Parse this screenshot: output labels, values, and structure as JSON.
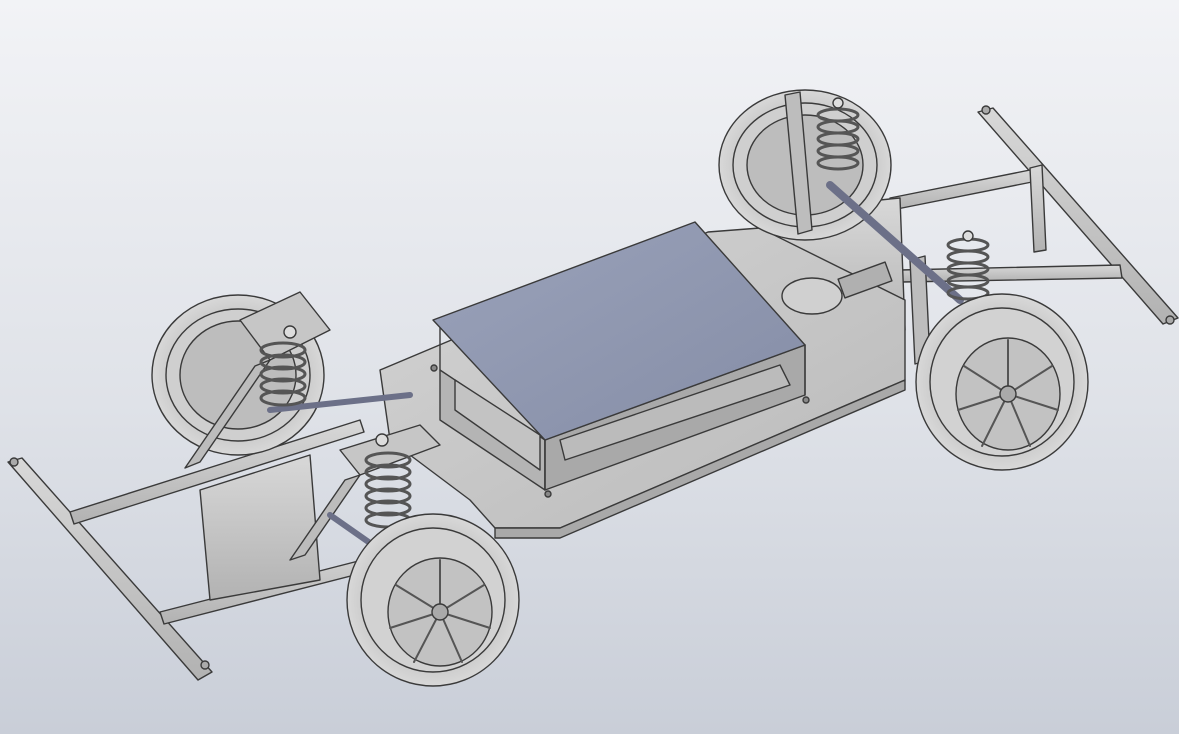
{
  "viewport": {
    "background_top": "#f2f3f6",
    "background_bottom": "#c9ced8"
  },
  "model": {
    "frame_color": "#c9c9c9",
    "frame_edge_color": "#3a3a3a",
    "tire_color": "#c8c8c8",
    "spring_color": "#e6e6e6",
    "battery_top_color": "#8f97b0",
    "plate_color": "#c5c5c5"
  }
}
